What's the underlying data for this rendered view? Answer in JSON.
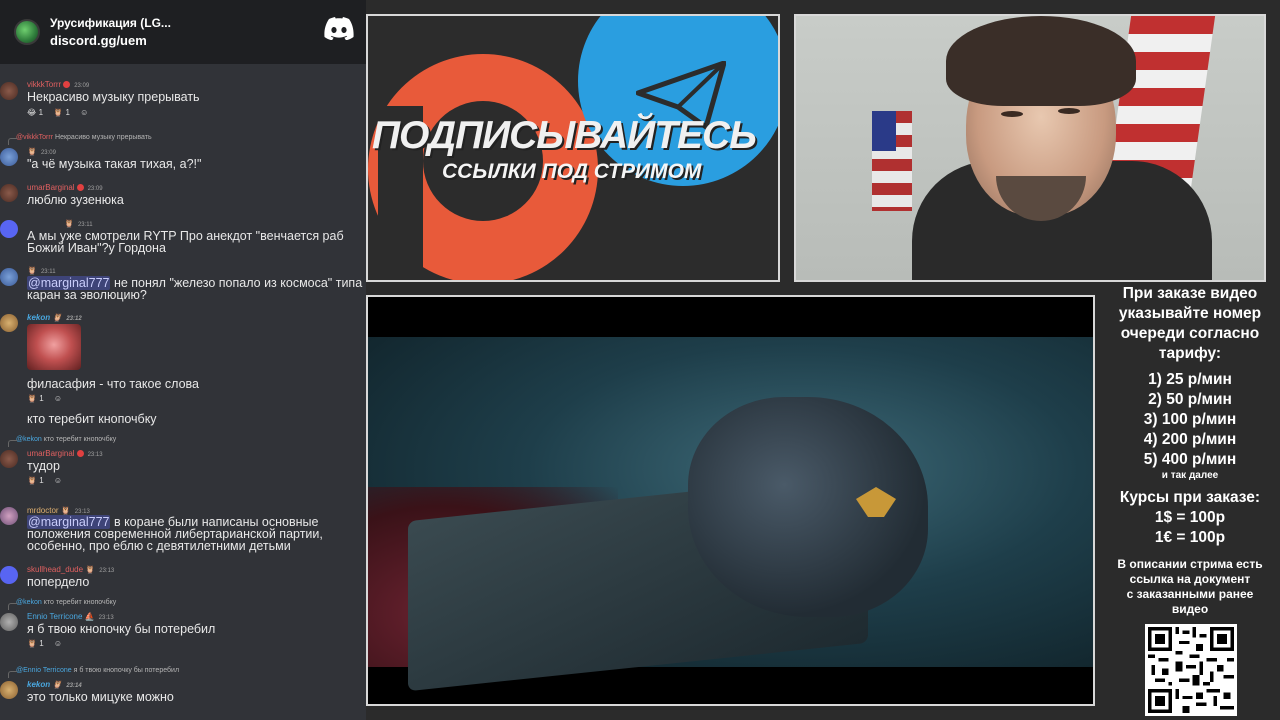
{
  "server": {
    "name": "Урусификация (LG...",
    "link": "discord.gg/uem"
  },
  "messages": [
    {
      "user": "vikkkTorrr",
      "time": "23:09",
      "text": "Некрасиво музыку прерывать",
      "reactions": [
        "1",
        "1"
      ]
    },
    {
      "reply_user": "@vikkkTorrr",
      "reply_text": "Некрасиво музыку прерывать",
      "time": "23:09",
      "text": "\"а чё музыка такая тихая, а?!\""
    },
    {
      "user": "umarBarginal",
      "time": "23:09",
      "text": "люблю зузенюка"
    },
    {
      "time": "23:11",
      "text": "А мы уже смотрели RYTP Про анекдот \"венчается раб Божий Иван\"?у Гордона"
    },
    {
      "time": "23:11",
      "mention": "@marginal777",
      "text": " не понял \"железо попало из космоса\" типа каран за эволюцию?"
    },
    {
      "user": "kekon",
      "time": "23:12",
      "text": "филасафия - что такое слова",
      "reactions": [
        "1"
      ],
      "text2": "кто теребит кнопочбку"
    },
    {
      "reply_user": "@kekon",
      "reply_text": "кто теребит кнопочбку",
      "user": "umarBarginal",
      "time": "23:13",
      "text": "тудор",
      "reactions": [
        "1"
      ]
    },
    {
      "user": "mrdoctor",
      "time": "23:13",
      "mention": "@marginal777",
      "text": " в коране были написаны основные положения современной либертарианской партии, особенно, про еблю с девятилетними детьми"
    },
    {
      "user": "skullhead_dude",
      "time": "23:13",
      "text": "попердело"
    },
    {
      "reply_user": "@kekon",
      "reply_text": "кто теребит кнопочбку",
      "user": "Ennio Terricone",
      "time": "23:13",
      "text": "я б твою кнопочку бы потеребил",
      "reactions": [
        "1"
      ]
    },
    {
      "reply_user": "@Ennio Terricone",
      "reply_text": "я б твою кнопочку бы потеребил",
      "user": "kekon",
      "time": "23:14",
      "text": "это только мицуке можно"
    }
  ],
  "promo": {
    "title": "ПОДПИСЫВАЙТЕСЬ",
    "subtitle": "ССЫЛКИ ПОД СТРИМОМ"
  },
  "info": {
    "intro": [
      "При заказе видео",
      "указывайте номер",
      "очереди согласно",
      "тарифу:"
    ],
    "tariffs": [
      "1) 25 р/мин",
      "2) 50 р/мин",
      "3) 100 р/мин",
      "4) 200 р/мин",
      "5) 400 р/мин"
    ],
    "and_more": "и так далее",
    "rates_title": "Курсы при заказе:",
    "rates": [
      "1$ = 100р",
      "1€ = 100р"
    ],
    "desc": [
      "В описании стрима есть",
      "ссылка на документ",
      "с заказанными ранее",
      "видео"
    ]
  },
  "colors": {
    "discord_bg": "#313338",
    "header_bg": "#1e1f22",
    "mention": "#c9cdfb",
    "patreon": "#e85a3a",
    "telegram": "#2a9ee0",
    "username_red": "#e06060",
    "username_blue": "#4aa8e0"
  }
}
